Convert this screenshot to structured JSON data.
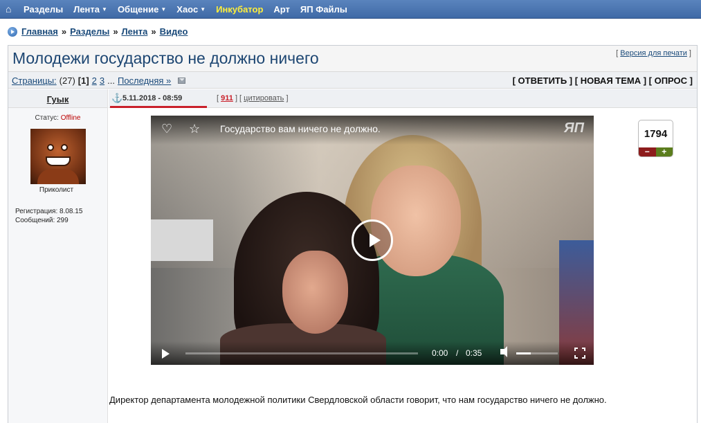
{
  "nav": {
    "home_icon": "home-icon",
    "items": [
      {
        "label": "Разделы",
        "caret": false
      },
      {
        "label": "Лента",
        "caret": true
      },
      {
        "label": "Общение",
        "caret": true
      },
      {
        "label": "Хаос",
        "caret": true
      },
      {
        "label": "Инкубатор",
        "caret": false,
        "color": "#ffef3a"
      },
      {
        "label": "Арт",
        "caret": false
      },
      {
        "label": "ЯП Файлы",
        "caret": false
      }
    ],
    "caret_glyph": "▼"
  },
  "breadcrumb": {
    "items": [
      "Главная",
      "Разделы",
      "Лента",
      "Видео"
    ],
    "separator": "»"
  },
  "topic": {
    "title": "Молодежи государство не должно ничего",
    "print_link": "Версия для печати"
  },
  "pagination": {
    "label": "Страницы:",
    "count": "(27)",
    "current": "[1]",
    "pages": [
      "2",
      "3"
    ],
    "ellipsis": "...",
    "last": "Последняя »"
  },
  "actions": "[ ОТВЕТИТЬ ] [ НОВАЯ ТЕМА ] [ ОПРОС ]",
  "author": {
    "name": "Гуык",
    "status_label": "Статус:",
    "status_value": "Offline",
    "rank": "Приколист",
    "registration": "Регистрация: 8.08.15",
    "posts": "Сообщений: 299"
  },
  "post": {
    "date": "5.11.2018 - 08:59",
    "open_bracket": "[",
    "number": "911",
    "mid_bracket": "] [",
    "quote": "цитировать",
    "close_bracket": "]",
    "text": "Директор департамента молодежной политики Свердловской области говорит, что нам государство ничего не должно."
  },
  "video": {
    "title": "Государство вам ничего не должно.",
    "logo": "ЯП",
    "time_current": "0:00",
    "time_separator": "/",
    "time_total": "0:35",
    "progress": 0,
    "volume": 0.35
  },
  "rating": {
    "score": "1794",
    "minus": "−",
    "plus": "+"
  },
  "colors": {
    "nav_bg": "#4a75b0",
    "accent_yellow": "#ffef3a",
    "link": "#1a4a7a",
    "post_number": "#c9202a",
    "minus_bg": "#8d1c1c",
    "plus_bg": "#5b7d1d"
  }
}
